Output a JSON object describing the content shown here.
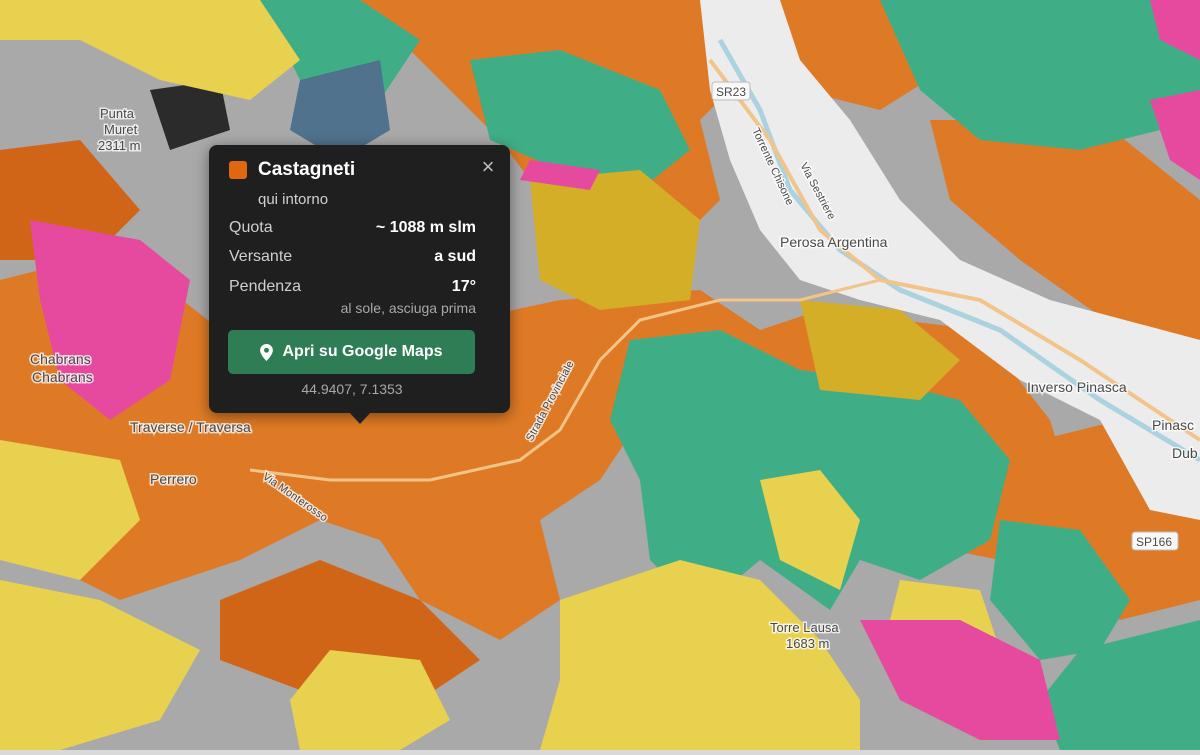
{
  "map": {
    "place_labels": [
      "Punta",
      "Muret",
      "2311 m",
      "Perosa Argentina",
      "Inverso Pinasca",
      "Pinasc",
      "Dub",
      "Chabrans",
      "Chabrans",
      "Traverse / Traversa",
      "Perrero",
      "Via Monterosso",
      "Torre Lausa",
      "1683 m"
    ],
    "road_labels": [
      "SR23",
      "Via Sestriere",
      "Torrente Chisone",
      "Strada Provinciale",
      "SP166"
    ]
  },
  "colors": {
    "castagneti": "#e0660f",
    "chestnut_area": "#de7a25",
    "broadleaf": "#3fae86",
    "meadow": "#e8d14f",
    "ochre": "#d5ae28",
    "magenta": "#e64a9e",
    "conifer": "#50728c",
    "rock": "#9a9a9a",
    "urban": "#ececec",
    "button": "#2e7d55"
  },
  "popup": {
    "title": "Castagneti",
    "subtitle": "qui intorno",
    "rows": [
      {
        "key": "Quota",
        "value": "~ 1088 m slm"
      },
      {
        "key": "Versante",
        "value": "a sud"
      },
      {
        "key": "Pendenza",
        "value": "17°"
      }
    ],
    "note": "al sole, asciuga prima",
    "button_label": "Apri su Google Maps",
    "button_icon": "map-pin-icon",
    "coords": "44.9407, 7.1353",
    "close_label": "×"
  }
}
